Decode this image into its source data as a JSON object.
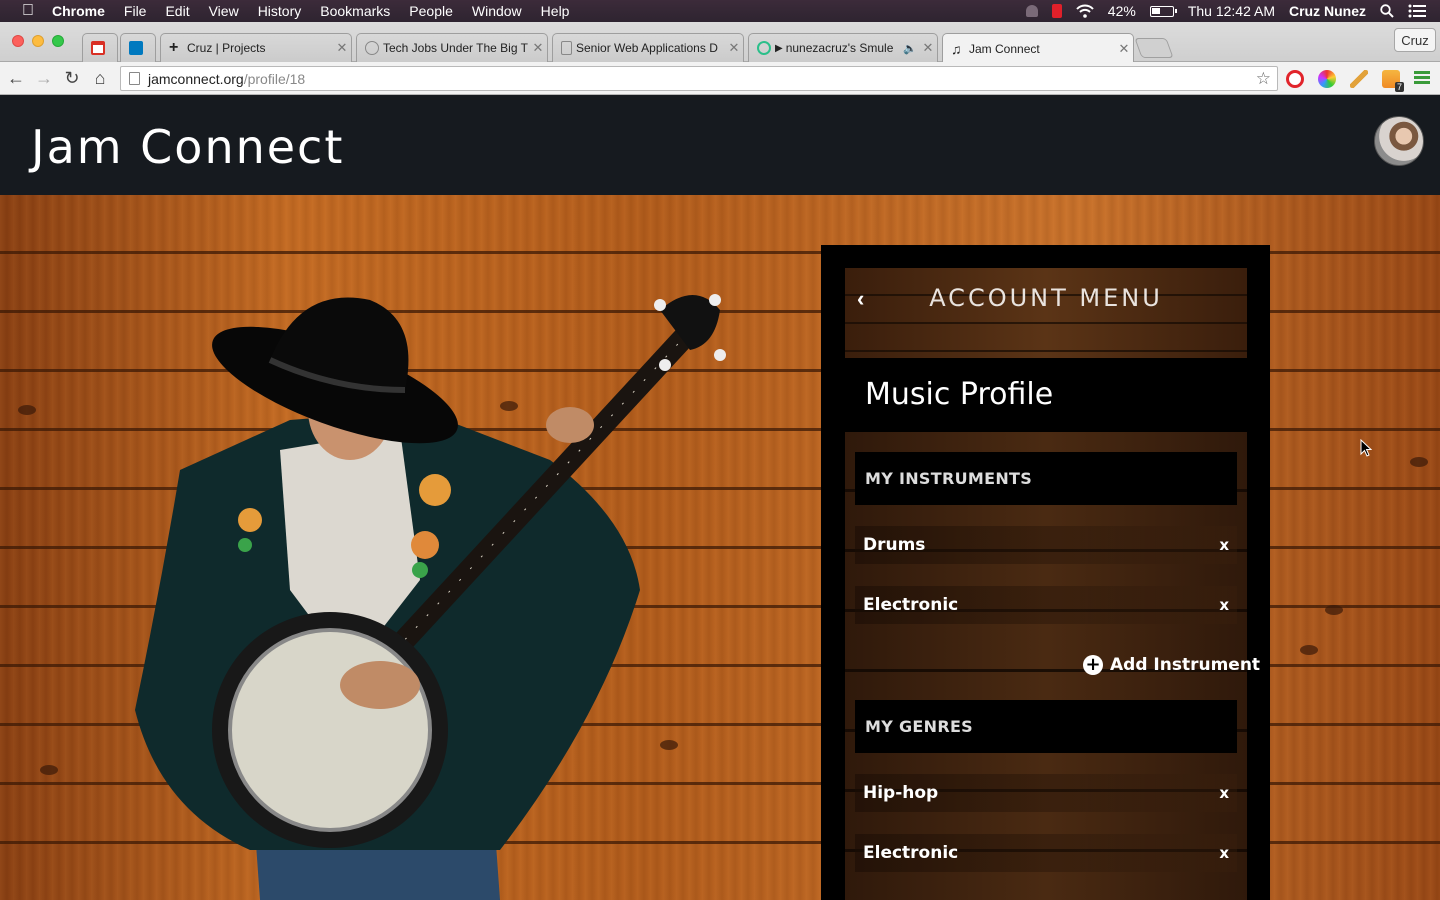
{
  "menubar": {
    "app": "Chrome",
    "items": [
      "File",
      "Edit",
      "View",
      "History",
      "Bookmarks",
      "People",
      "Window",
      "Help"
    ],
    "battery": "42%",
    "clock": "Thu 12:42 AM",
    "user": "Cruz Nunez",
    "icons": [
      "apple-icon",
      "notification-icon",
      "wifi-icon",
      "battery-icon",
      "spotlight-icon",
      "notification-center-icon"
    ]
  },
  "browser": {
    "tabs": [
      {
        "title": "",
        "icon": "gmail-icon",
        "color": "#d93025"
      },
      {
        "title": "",
        "icon": "trello-icon",
        "color": "#0079bf"
      },
      {
        "title": "Cruz | Projects",
        "icon": "plus-icon"
      },
      {
        "title": "Tech Jobs Under The Big T",
        "icon": "globe-icon"
      },
      {
        "title": "Senior Web Applications D",
        "icon": "document-icon"
      },
      {
        "title": "nunezacruz's Smule",
        "icon": "smule-icon"
      },
      {
        "title": "Jam Connect",
        "icon": "music-note-icon",
        "active": true
      }
    ],
    "profile_button": "Cruz",
    "url_host": "jamconnect.org",
    "url_path": "/profile/18",
    "extension_badge": "7"
  },
  "site": {
    "title": "Jam Connect",
    "avatar_alt": "user-avatar"
  },
  "account_menu": {
    "title": "ACCOUNT MENU",
    "section_title": "Music Profile",
    "instruments_heading": "MY INSTRUMENTS",
    "instruments": [
      "Drums",
      "Electronic"
    ],
    "add_instrument_label": "Add Instrument",
    "genres_heading": "MY GENRES",
    "genres": [
      "Hip-hop",
      "Electronic"
    ],
    "remove_label": "x"
  }
}
